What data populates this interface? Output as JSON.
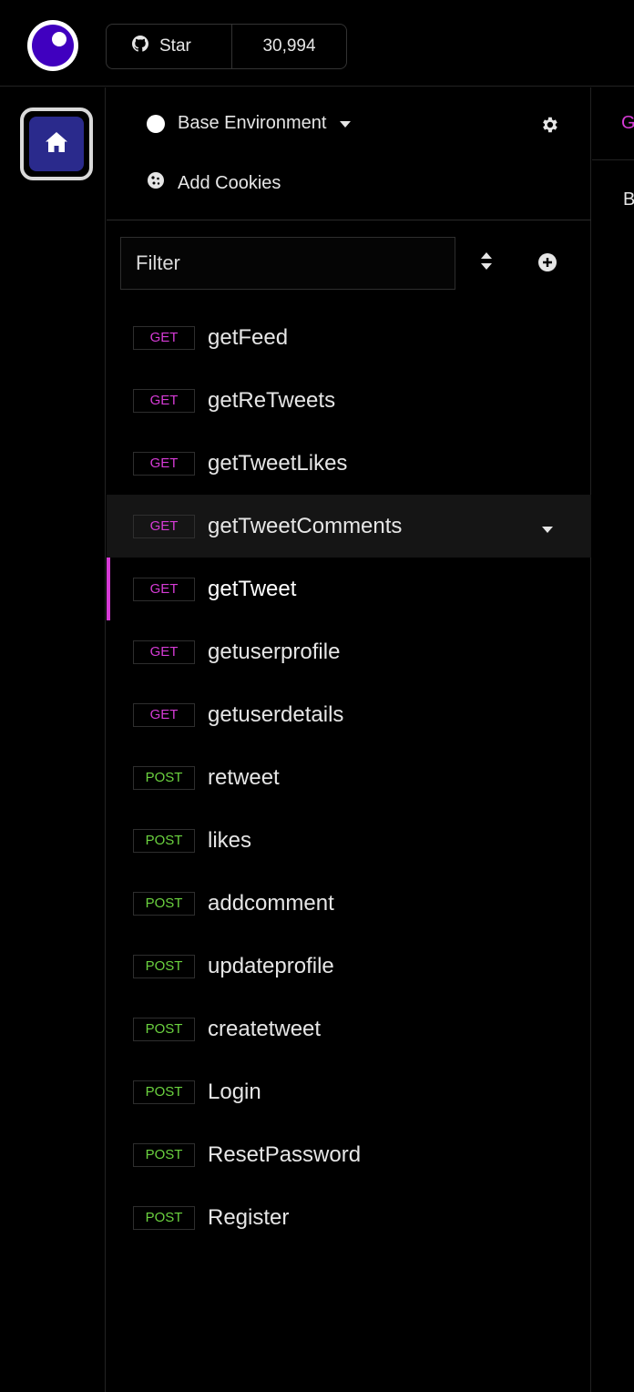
{
  "header": {
    "star_label": "Star",
    "star_count": "30,994"
  },
  "sidebar": {
    "environment_label": "Base Environment",
    "cookies_label": "Add Cookies",
    "filter_placeholder": "Filter",
    "requests": [
      {
        "method": "GET",
        "name": "getFeed"
      },
      {
        "method": "GET",
        "name": "getReTweets"
      },
      {
        "method": "GET",
        "name": "getTweetLikes"
      },
      {
        "method": "GET",
        "name": "getTweetComments"
      },
      {
        "method": "GET",
        "name": "getTweet"
      },
      {
        "method": "GET",
        "name": "getuserprofile"
      },
      {
        "method": "GET",
        "name": "getuserdetails"
      },
      {
        "method": "POST",
        "name": "retweet"
      },
      {
        "method": "POST",
        "name": "likes"
      },
      {
        "method": "POST",
        "name": "addcomment"
      },
      {
        "method": "POST",
        "name": "updateprofile"
      },
      {
        "method": "POST",
        "name": "createtweet"
      },
      {
        "method": "POST",
        "name": "Login"
      },
      {
        "method": "POST",
        "name": "ResetPassword"
      },
      {
        "method": "POST",
        "name": "Register"
      }
    ],
    "hovered_request": "getTweetComments",
    "active_request": "getTweet"
  },
  "right_panel": {
    "tab_label": "G",
    "sub_label": "B"
  },
  "colors": {
    "accent": "#d63bd6",
    "get": "#d63bd6",
    "post": "#6bd23f",
    "logo": "#4000bf"
  }
}
